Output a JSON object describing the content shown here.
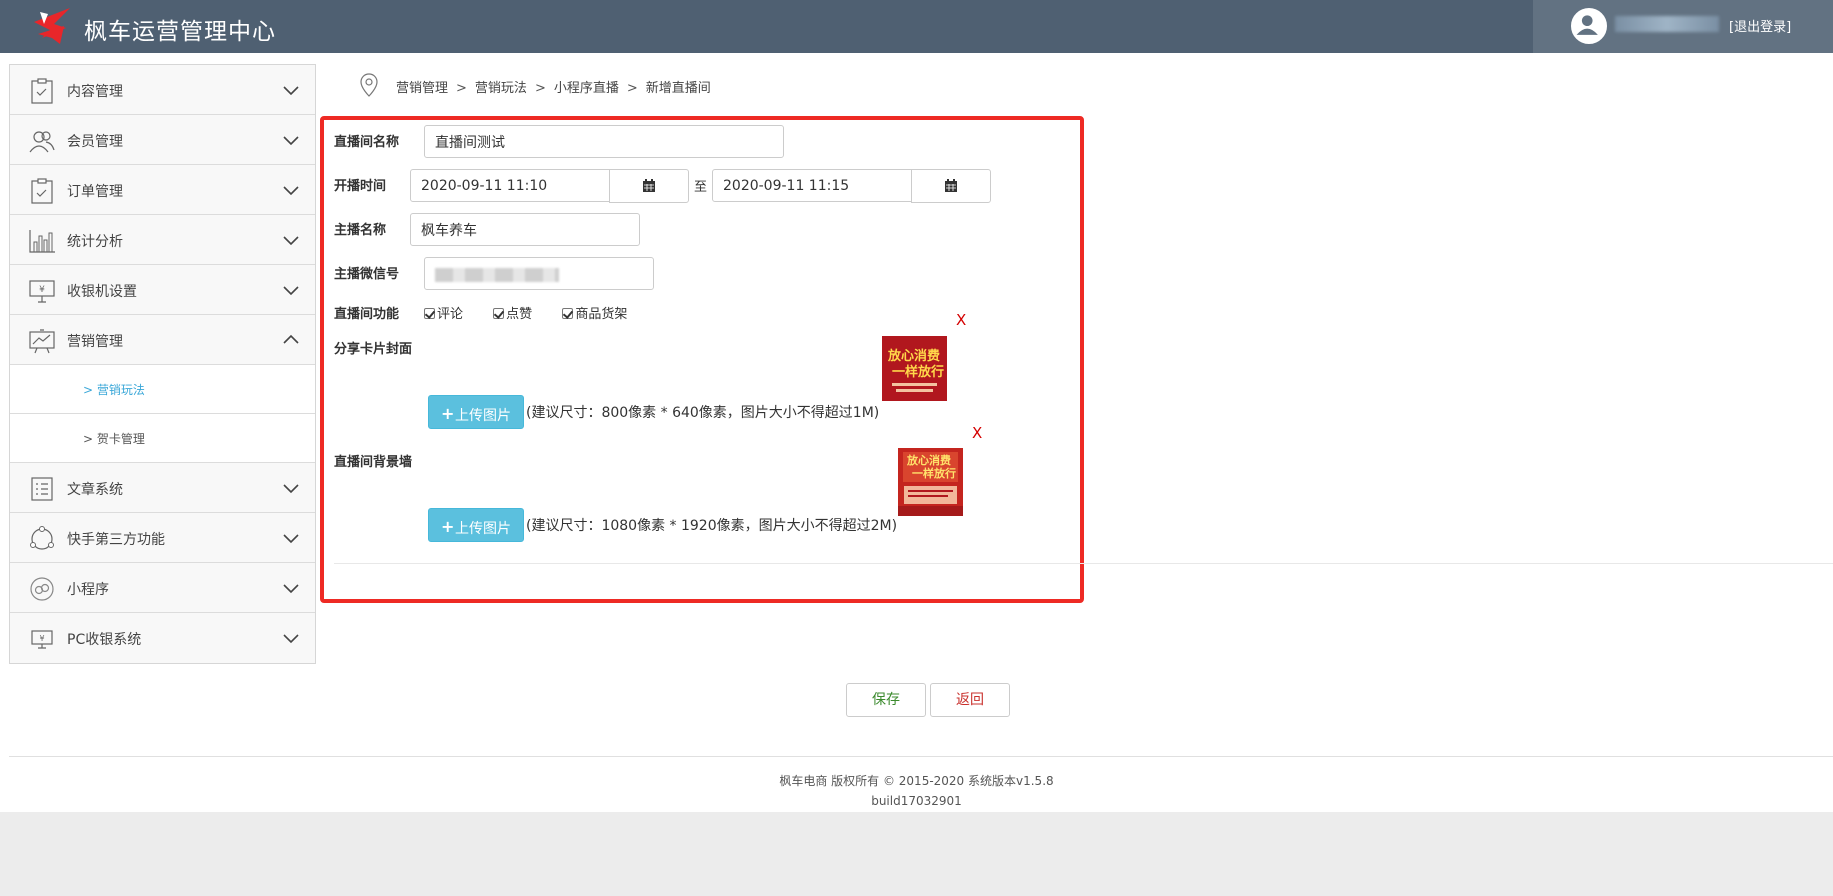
{
  "header": {
    "title": "枫车运营管理中心",
    "logout": "[退出登录]"
  },
  "sidebar": {
    "items": [
      {
        "label": "内容管理",
        "icon": "clipboard-icon"
      },
      {
        "label": "会员管理",
        "icon": "users-icon"
      },
      {
        "label": "订单管理",
        "icon": "clipboard-check-icon"
      },
      {
        "label": "统计分析",
        "icon": "bar-chart-icon"
      },
      {
        "label": "收银机设置",
        "icon": "cashier-monitor-icon"
      },
      {
        "label": "营销管理",
        "icon": "trend-board-icon",
        "expanded": true,
        "children": [
          {
            "label": "> 营销玩法",
            "active": true
          },
          {
            "label": "> 贺卡管理"
          }
        ]
      },
      {
        "label": "文章系统",
        "icon": "list-icon"
      },
      {
        "label": "快手第三方功能",
        "icon": "share-circle-icon"
      },
      {
        "label": "小程序",
        "icon": "mini-program-icon"
      },
      {
        "label": "PC收银系统",
        "icon": "pc-cashier-icon"
      }
    ]
  },
  "breadcrumb": [
    "营销管理",
    "营销玩法",
    "小程序直播",
    "新增直播间"
  ],
  "form": {
    "room_name": {
      "label": "直播间名称",
      "value": "直播间测试"
    },
    "time": {
      "label": "开播时间",
      "start": "2020-09-11 11:10",
      "to": "至",
      "end": "2020-09-11 11:15"
    },
    "anchor_name": {
      "label": "主播名称",
      "value": "枫车养车"
    },
    "anchor_wechat": {
      "label": "主播微信号"
    },
    "features": {
      "label": "直播间功能",
      "options": [
        "评论",
        "点赞",
        "商品货架"
      ]
    },
    "share_cover": {
      "label": "分享卡片封面",
      "upload": "上传图片",
      "hint": "(建议尺寸：800像素 * 640像素，图片大小不得超过1M)",
      "delete": "X",
      "thumb_text": [
        "放心消费",
        "一样放行"
      ]
    },
    "background": {
      "label": "直播间背景墙",
      "upload": "上传图片",
      "hint": "(建议尺寸：1080像素 * 1920像素，图片大小不得超过2M)",
      "delete": "X",
      "thumb_text": [
        "放心消费",
        "一样放行"
      ]
    }
  },
  "actions": {
    "save": "保存",
    "back": "返回"
  },
  "footer": {
    "copyright": "枫车电商 版权所有 © 2015-2020 系统版本v1.5.8",
    "build": "build17032901"
  },
  "colors": {
    "header": "#4f6072",
    "highlight_border": "#ee2a24",
    "upload_button": "#5bc0de",
    "active_link": "#3aa7d8"
  }
}
